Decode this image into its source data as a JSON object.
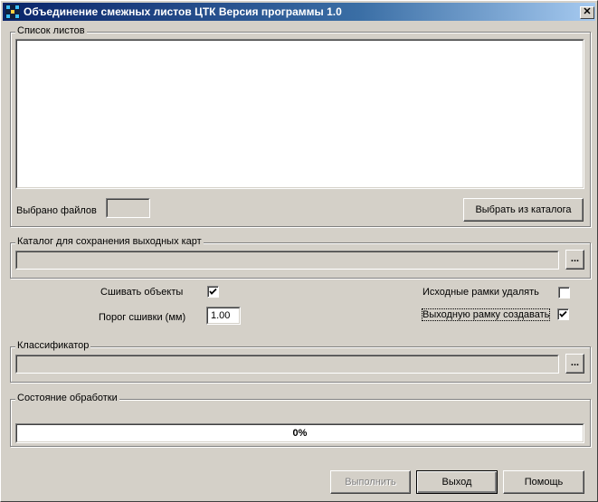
{
  "window": {
    "title": "Объединение смежных листов ЦТК  Версия программы 1.0",
    "close_glyph": "✕"
  },
  "sheets": {
    "legend": "Список листов",
    "selected_files_label": "Выбрано файлов",
    "selected_files_value": "",
    "choose_button": "Выбрать из каталога"
  },
  "output_dir": {
    "legend": "Каталог для сохранения выходных карт",
    "value": "",
    "browse_button": "..."
  },
  "options": {
    "stitch_objects_label": "Сшивать объекты",
    "stitch_objects_checked": true,
    "stitch_threshold_label": "Порог сшивки (мм)",
    "stitch_threshold_value": "1.00",
    "delete_source_frames_label": "Исходные рамки удалять",
    "delete_source_frames_checked": false,
    "create_output_frame_label": "Выходную рамку создавать",
    "create_output_frame_checked": true
  },
  "classifier": {
    "legend": "Классификатор",
    "value": "",
    "browse_button": "..."
  },
  "progress": {
    "legend": "Состояние обработки",
    "percent": 0,
    "text": "0%"
  },
  "footer": {
    "run_button": "Выполнить",
    "exit_button": "Выход",
    "help_button": "Помощь"
  }
}
